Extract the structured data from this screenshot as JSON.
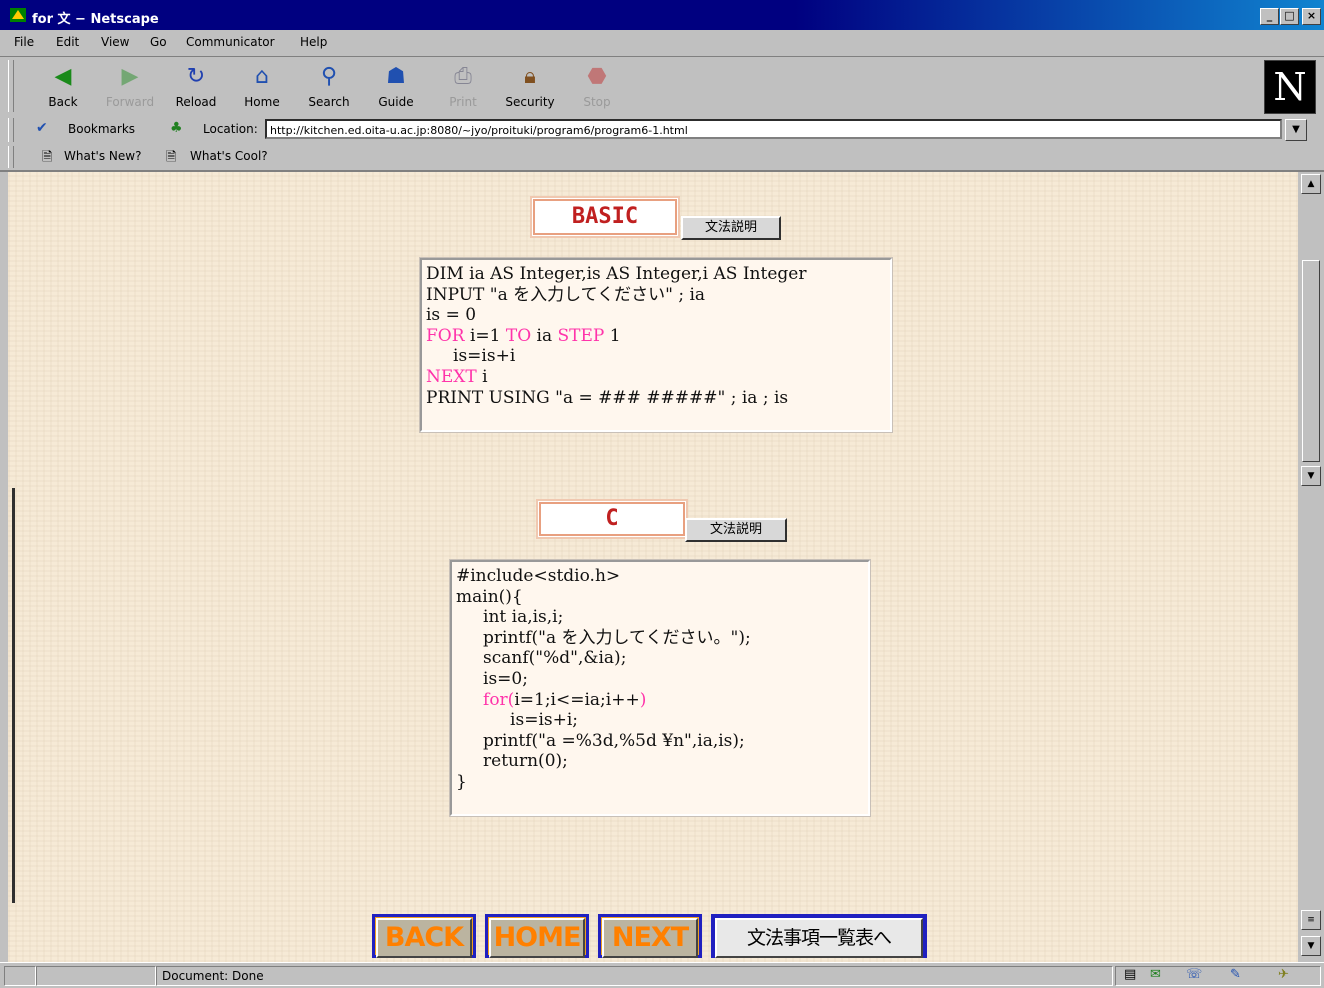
{
  "window": {
    "title": "for 文 − Netscape",
    "controls": [
      "_",
      "□",
      "×"
    ]
  },
  "menu": [
    "File",
    "Edit",
    "View",
    "Go",
    "Communicator",
    "Help"
  ],
  "toolbar": [
    {
      "label": "Back",
      "icon": "back-arrow-icon",
      "enabled": true
    },
    {
      "label": "Forward",
      "icon": "forward-arrow-icon",
      "enabled": false
    },
    {
      "label": "Reload",
      "icon": "reload-icon",
      "enabled": true
    },
    {
      "label": "Home",
      "icon": "home-icon",
      "enabled": true
    },
    {
      "label": "Search",
      "icon": "search-icon",
      "enabled": true
    },
    {
      "label": "Guide",
      "icon": "guide-icon",
      "enabled": true
    },
    {
      "label": "Print",
      "icon": "printer-icon",
      "enabled": false
    },
    {
      "label": "Security",
      "icon": "lock-icon",
      "enabled": true
    },
    {
      "label": "Stop",
      "icon": "stop-icon",
      "enabled": false
    }
  ],
  "location": {
    "bookmarks_label": "Bookmarks",
    "label": "Location:",
    "url": "http://kitchen.ed.oita-u.ac.jp:8080/~jyo/proituki/program6/program6-1.html"
  },
  "personal": [
    "What's New?",
    "What's Cool?"
  ],
  "basic": {
    "heading": "BASIC",
    "grammar_button": "文法説明",
    "lines": [
      [
        "DIM ia AS Integer,is AS Integer,i AS Integer"
      ],
      [
        "INPUT \"a を入力してください\" ; ia"
      ],
      [
        "is = 0"
      ],
      [
        "FOR",
        " i=1 ",
        "TO",
        " ia ",
        "STEP",
        " 1"
      ],
      [
        "     is=is+i"
      ],
      [
        "NEXT",
        " i"
      ],
      [
        "PRINT USING \"a = ### #####\" ; ia ; is"
      ]
    ]
  },
  "c": {
    "heading": "C",
    "grammar_button": "文法説明",
    "lines": [
      [
        "#include<stdio.h>"
      ],
      [
        "main(){"
      ],
      [
        "     int ia,is,i;"
      ],
      [
        "     printf(\"a を入力してください。\");"
      ],
      [
        "     scanf(\"%d\",&ia);"
      ],
      [
        "     is=0;"
      ],
      [
        "     ",
        "for(",
        "i=1;i<=ia;i++",
        ")"
      ],
      [
        "          is=is+i;"
      ],
      [
        "     printf(\"a =%3d,%5d ¥n\",ia,is);"
      ],
      [
        "     return(0);"
      ],
      [
        "}"
      ]
    ]
  },
  "nav": {
    "back": "BACK",
    "home": "HOME",
    "next": "NEXT",
    "list": "文法事項一覧表へ"
  },
  "status": {
    "text": "Document: Done"
  },
  "colors": {
    "keyword": "#ff33aa",
    "heading_text": "#c02020",
    "title_bar": "#000080"
  }
}
